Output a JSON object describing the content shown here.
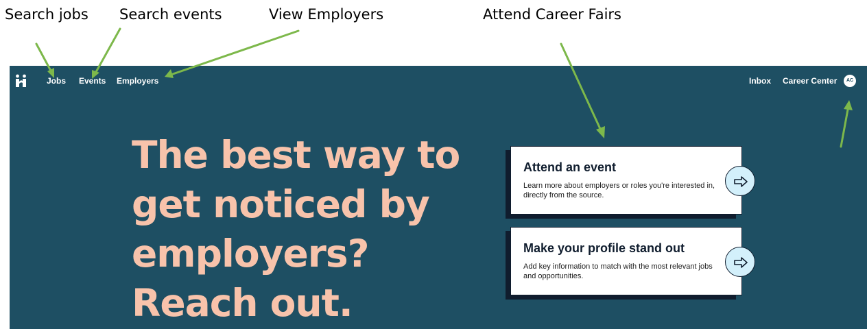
{
  "annotations": {
    "jobs": "Search jobs",
    "events": "Search events",
    "employers": "View Employers",
    "career_fairs": "Attend Career Fairs"
  },
  "annotation_arrow_color": "#7db84b",
  "nav": {
    "logo_icon": "handshake-logo-icon",
    "jobs": "Jobs",
    "events": "Events",
    "employers": "Employers",
    "inbox": "Inbox",
    "career_center": "Career Center",
    "avatar_initials": "AC"
  },
  "hero": {
    "line1": "The best way to",
    "line2": "get noticed by",
    "line3": "employers?",
    "line4": "Reach out."
  },
  "cards": [
    {
      "title": "Attend an event",
      "description": "Learn more about employers or roles you're interested in, directly from the source.",
      "icon": "arrow-right-icon"
    },
    {
      "title": "Make your profile stand out",
      "description": "Add key information to match with the most relevant jobs and opportunities.",
      "icon": "arrow-right-icon"
    }
  ],
  "colors": {
    "background": "#1e4f63",
    "hero_text": "#f8c3ab",
    "card_shadow": "#101d2e",
    "arrow_circle": "#d3f0fb"
  }
}
